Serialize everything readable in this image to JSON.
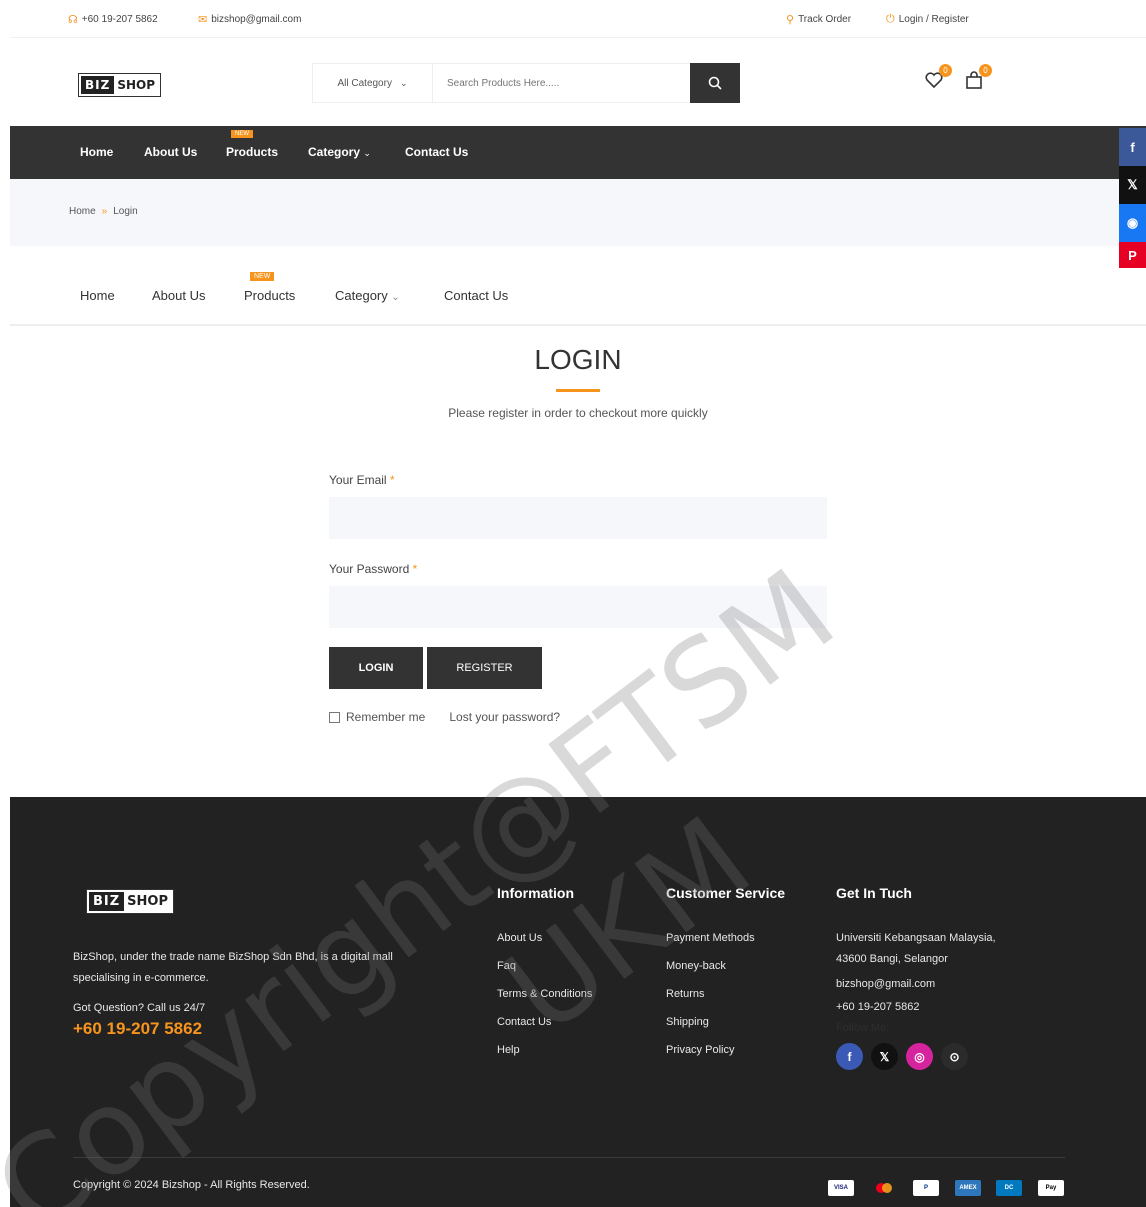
{
  "topbar": {
    "phone": "+60 19-207 5862",
    "email": "bizshop@gmail.com",
    "track_order": "Track Order",
    "login_register": "Login / Register"
  },
  "logo": {
    "part1": "BIZ",
    "part2": "SHOP"
  },
  "search": {
    "category_label": "All Category",
    "placeholder": "Search Products Here....."
  },
  "header": {
    "wishlist_count": "0",
    "cart_count": "0"
  },
  "nav": {
    "items": [
      "Home",
      "About Us",
      "Products",
      "Category",
      "Contact Us"
    ],
    "new_tag": "NEW"
  },
  "breadcrumb": {
    "home": "Home",
    "separator": "»",
    "current": "Login"
  },
  "login": {
    "title": "LOGIN",
    "subtitle": "Please register in order to checkout more quickly",
    "email_label": "Your Email",
    "password_label": "Your Password",
    "required_mark": "*",
    "login_button": "LOGIN",
    "register_button": "REGISTER",
    "remember_me": "Remember me",
    "lost_password": "Lost your password?"
  },
  "watermark": {
    "line1": "Copyright@FTSM",
    "line2": "UKM"
  },
  "footer": {
    "description": "BizShop, under the trade name BizShop Sdn Bhd, is a digital mall specialising in e-commerce.",
    "question": "Got Question? Call us 24/7",
    "phone": "+60 19-207 5862",
    "information": {
      "heading": "Information",
      "links": [
        "About Us",
        "Faq",
        "Terms & Conditions",
        "Contact Us",
        "Help"
      ]
    },
    "customer_service": {
      "heading": "Customer Service",
      "links": [
        "Payment Methods",
        "Money-back",
        "Returns",
        "Shipping",
        "Privacy Policy"
      ]
    },
    "contact": {
      "heading": "Get In Tuch",
      "address_line1": "Universiti Kebangsaan Malaysia,",
      "address_line2": "43600 Bangi, Selangor",
      "email": "bizshop@gmail.com",
      "phone": "+60 19-207 5862",
      "follow": "Follow Me:"
    },
    "copyright": "Copyright © 2024 Bizshop - All Rights Reserved.",
    "payments": [
      "VISA",
      "MC",
      "P",
      "AMEX",
      "DC",
      "Pay"
    ]
  },
  "colors": {
    "accent": "#f7941d",
    "dark": "#333333",
    "footer": "#222222"
  }
}
